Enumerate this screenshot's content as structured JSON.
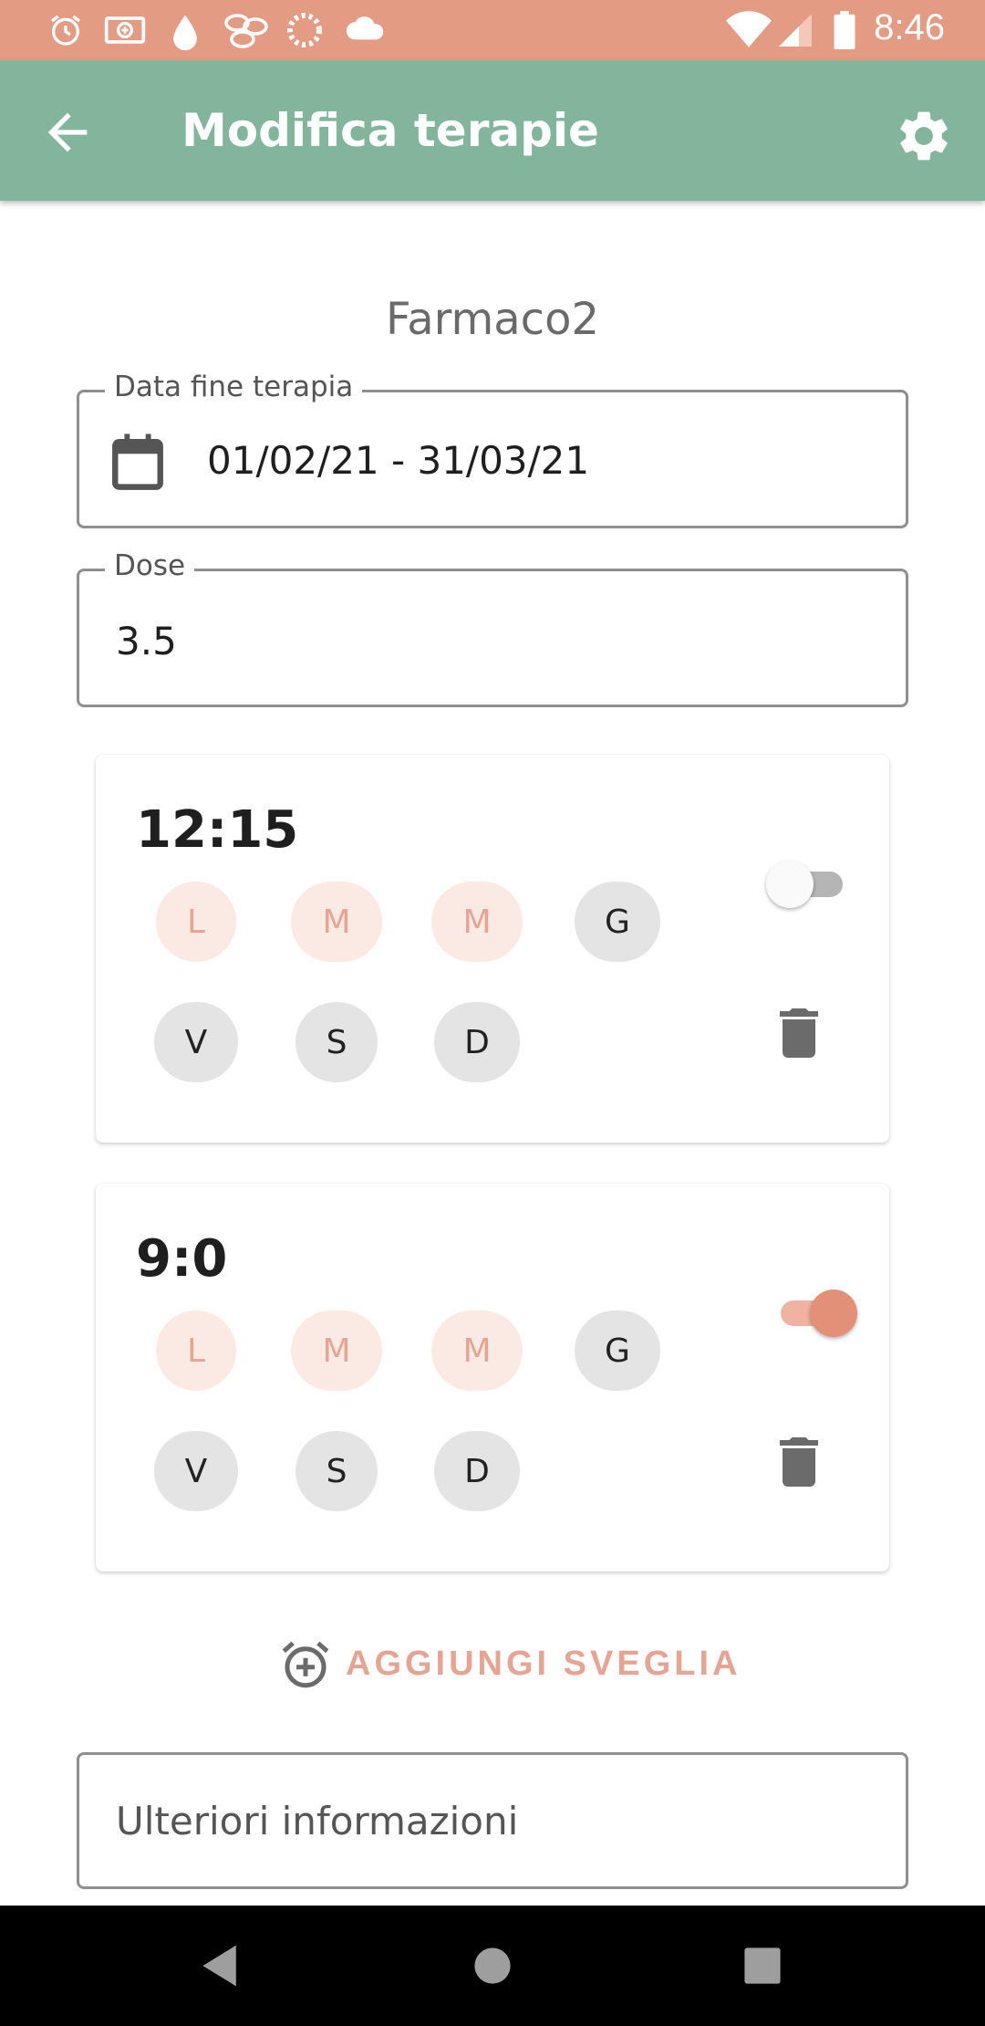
{
  "status_bar": {
    "time": "8:46",
    "icons": [
      "alarm-icon",
      "money-icon",
      "drop-icon",
      "pills-icon",
      "loading-icon",
      "cloud-icon",
      "wifi-icon",
      "signal-icon",
      "battery-icon"
    ]
  },
  "app_bar": {
    "title": "Modifica terapie",
    "back_icon": "arrow-back-icon",
    "settings_icon": "gear-icon"
  },
  "drug": {
    "name": "Farmaco2"
  },
  "date_field": {
    "label": "Data fine terapia",
    "value": "01/02/21 - 31/03/21",
    "icon": "calendar-icon"
  },
  "dose_field": {
    "label": "Dose",
    "value": "3.5"
  },
  "alarms": [
    {
      "time": "12:15",
      "enabled": false,
      "days_row1": [
        "L",
        "M",
        "M",
        "G"
      ],
      "days_row2": [
        "V",
        "S",
        "D"
      ],
      "day_states": [
        false,
        false,
        false,
        true,
        true,
        true,
        true
      ]
    },
    {
      "time": "9:0",
      "enabled": true,
      "days_row1": [
        "L",
        "M",
        "M",
        "G"
      ],
      "days_row2": [
        "V",
        "S",
        "D"
      ],
      "day_states": [
        false,
        false,
        false,
        true,
        true,
        true,
        true
      ]
    }
  ],
  "add_alarm": {
    "label": "AGGIUNGI SVEGLIA",
    "icon": "alarm-add-icon"
  },
  "notes_field": {
    "placeholder": "Ulteriori informazioni"
  },
  "colors": {
    "status_bar": "#e39b84",
    "app_bar": "#82b59b",
    "accent": "#e39078",
    "day_inactive_bg": "#fbe9e3",
    "day_inactive_text": "#e6a593",
    "day_active_bg": "#e4e4e4"
  }
}
